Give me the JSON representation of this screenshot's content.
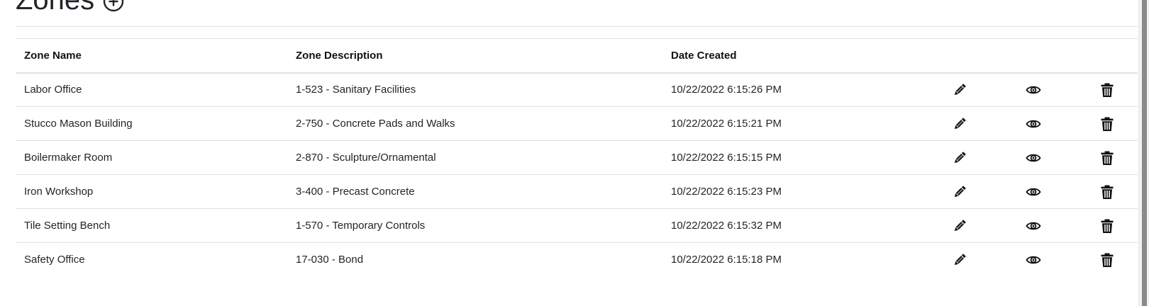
{
  "page": {
    "title": "Zones"
  },
  "table": {
    "headers": {
      "zone_name": "Zone Name",
      "zone_description": "Zone Description",
      "date_created": "Date Created"
    },
    "rows": [
      {
        "zone_name": "Labor Office",
        "zone_description": "1-523 - Sanitary Facilities",
        "date_created": "10/22/2022 6:15:26 PM"
      },
      {
        "zone_name": "Stucco Mason Building",
        "zone_description": "2-750 - Concrete Pads and Walks",
        "date_created": "10/22/2022 6:15:21 PM"
      },
      {
        "zone_name": "Boilermaker Room",
        "zone_description": "2-870 - Sculpture/Ornamental",
        "date_created": "10/22/2022 6:15:15 PM"
      },
      {
        "zone_name": "Iron Workshop",
        "zone_description": "3-400 - Precast Concrete",
        "date_created": "10/22/2022 6:15:23 PM"
      },
      {
        "zone_name": "Tile Setting Bench",
        "zone_description": "1-570 - Temporary Controls",
        "date_created": "10/22/2022 6:15:32 PM"
      },
      {
        "zone_name": "Safety Office",
        "zone_description": "17-030 - Bond",
        "date_created": "10/22/2022 6:15:18 PM"
      }
    ],
    "row_actions": [
      "pencil-icon",
      "eye-icon",
      "trash-icon"
    ]
  },
  "icons": {
    "add": "plus-circle-icon",
    "edit": "pencil-icon",
    "view": "eye-icon",
    "delete": "trash-icon"
  },
  "colors": {
    "text": "#212529",
    "border": "#dee2e6",
    "icon": "#111111"
  }
}
